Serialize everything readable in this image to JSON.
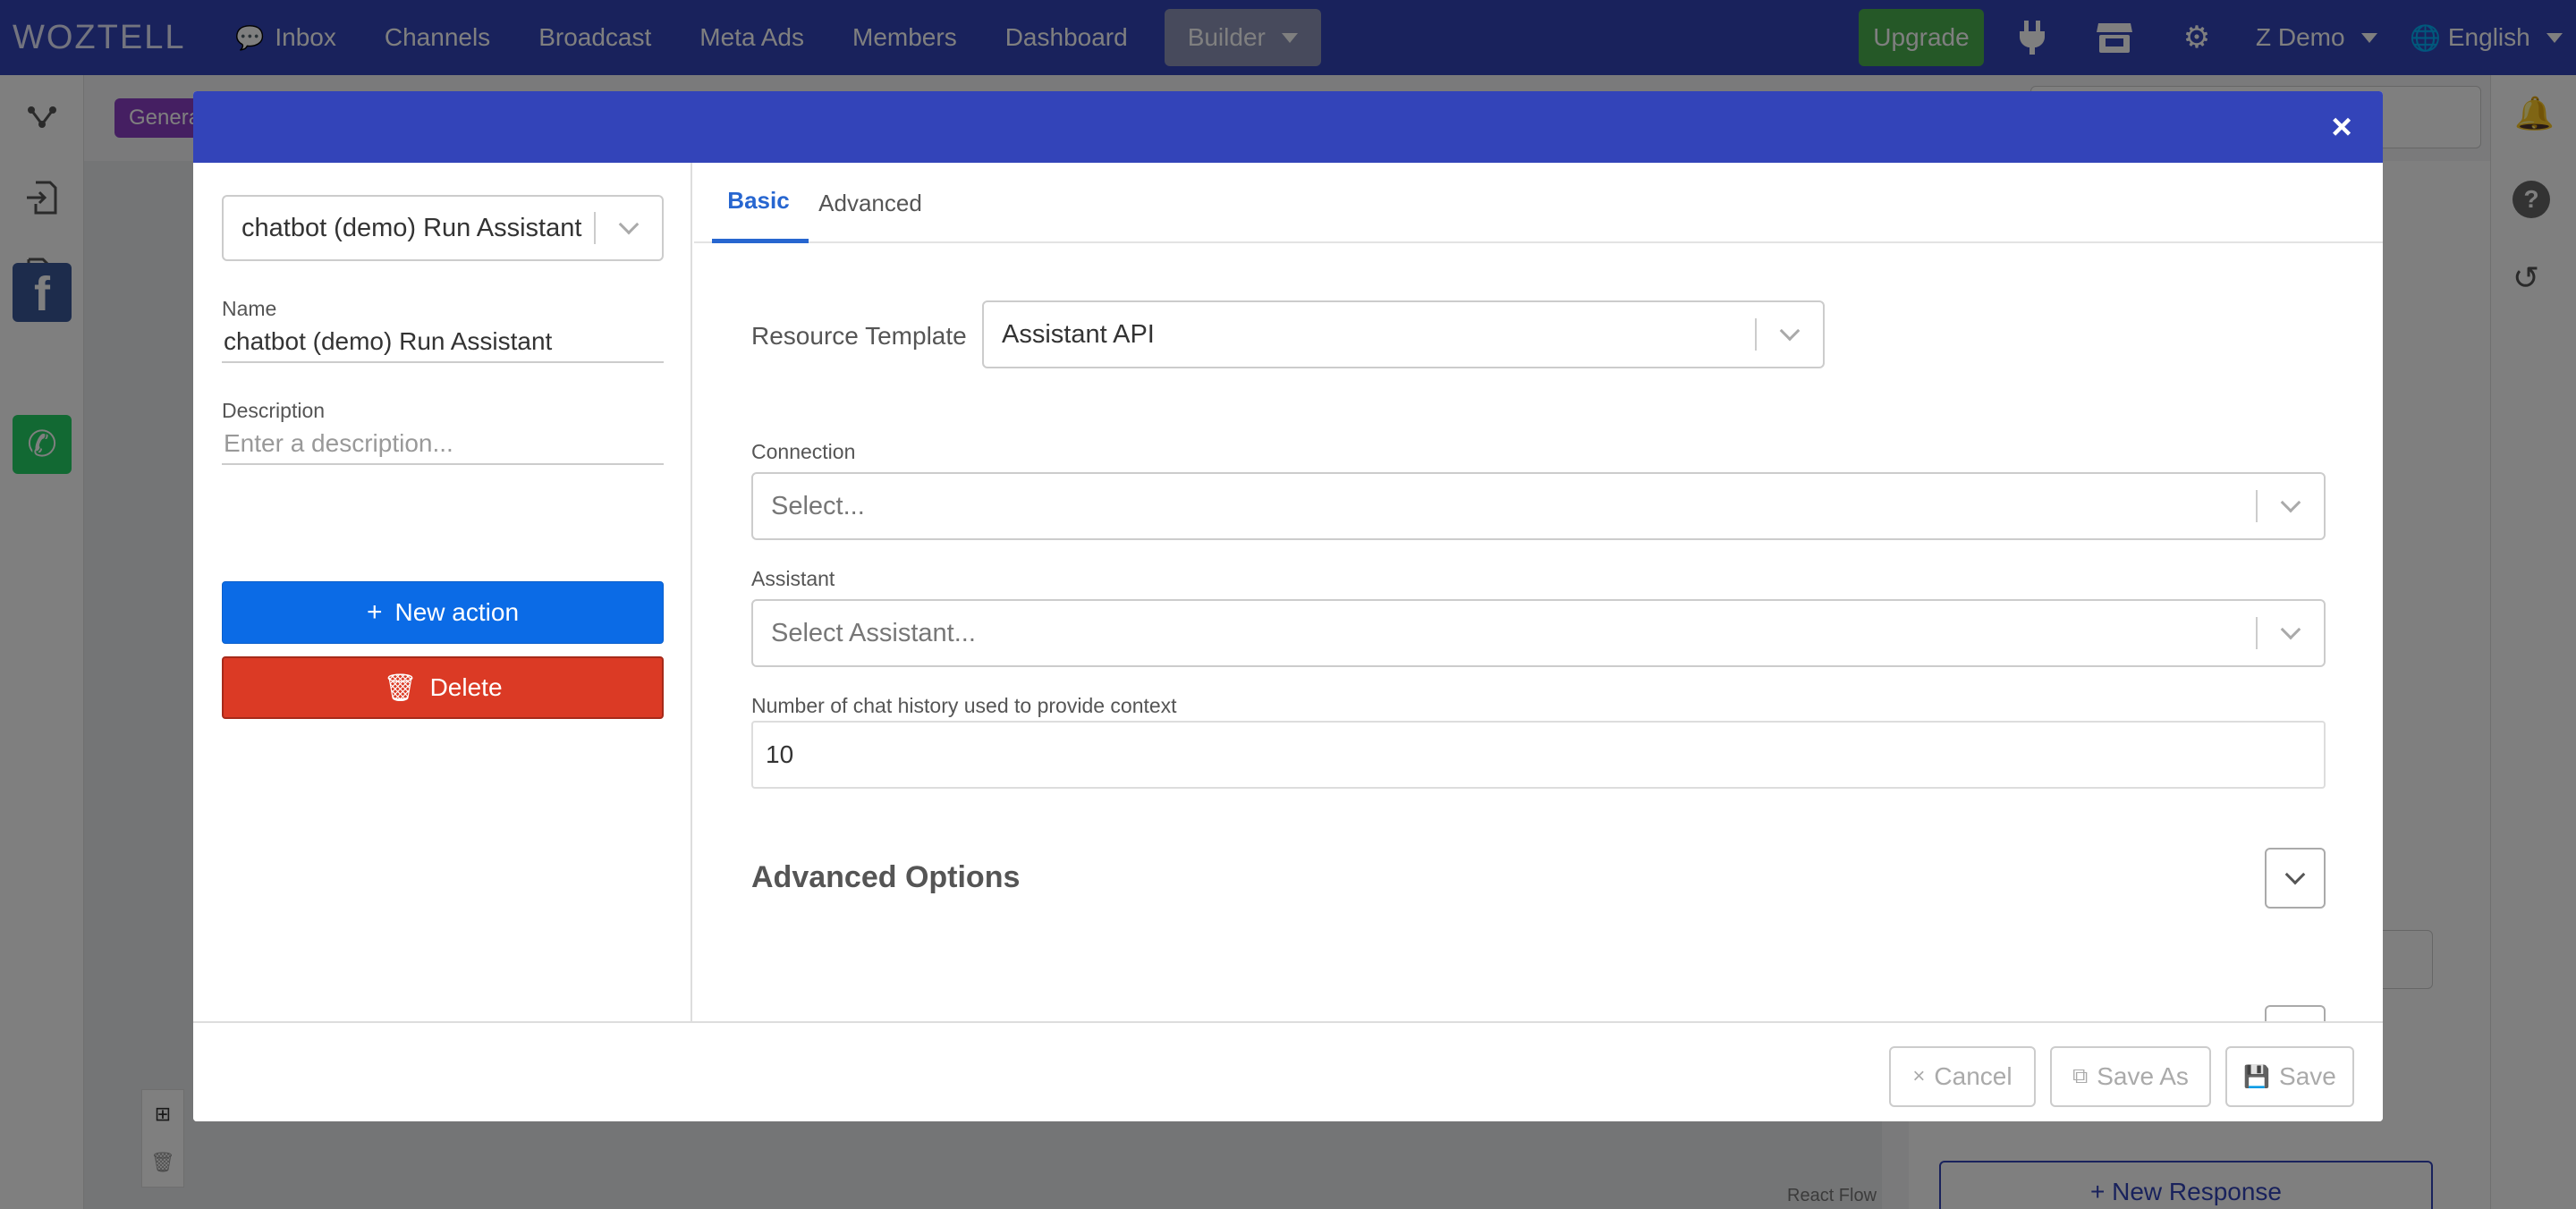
{
  "topnav": {
    "logo": "WOZTELL",
    "items": [
      {
        "label": "Inbox",
        "icon": "chat-icon"
      },
      {
        "label": "Channels"
      },
      {
        "label": "Broadcast"
      },
      {
        "label": "Meta Ads"
      },
      {
        "label": "Members"
      },
      {
        "label": "Dashboard"
      }
    ],
    "builder_label": "Builder",
    "upgrade_label": "Upgrade",
    "account_label": "Z Demo",
    "language_label": "English"
  },
  "workspace": {
    "badge_label": "Genera",
    "new_response_label": "+ New Response",
    "react_flow_label": "React Flow"
  },
  "modal": {
    "node_select_value": "chatbot (demo) Run Assistant",
    "name_label": "Name",
    "name_value": "chatbot (demo) Run Assistant",
    "description_label": "Description",
    "description_placeholder": "Enter a description...",
    "new_action_label": "New action",
    "delete_label": "Delete",
    "tabs": [
      {
        "label": "Basic",
        "active": true
      },
      {
        "label": "Advanced",
        "active": false
      }
    ],
    "resource_template_label": "Resource Template",
    "resource_template_value": "Assistant API",
    "connection_label": "Connection",
    "connection_placeholder": "Select...",
    "assistant_label": "Assistant",
    "assistant_placeholder": "Select Assistant...",
    "history_label": "Number of chat history used to provide context",
    "history_value": "10",
    "advanced_options_label": "Advanced Options",
    "cancel_label": "Cancel",
    "save_as_label": "Save As",
    "save_label": "Save"
  },
  "colors": {
    "nav_bg": "#3344b9",
    "upgrade": "#4bb04f",
    "primary_button": "#0b6be6",
    "danger_button": "#db3a25",
    "active_tab": "#2766d0"
  }
}
